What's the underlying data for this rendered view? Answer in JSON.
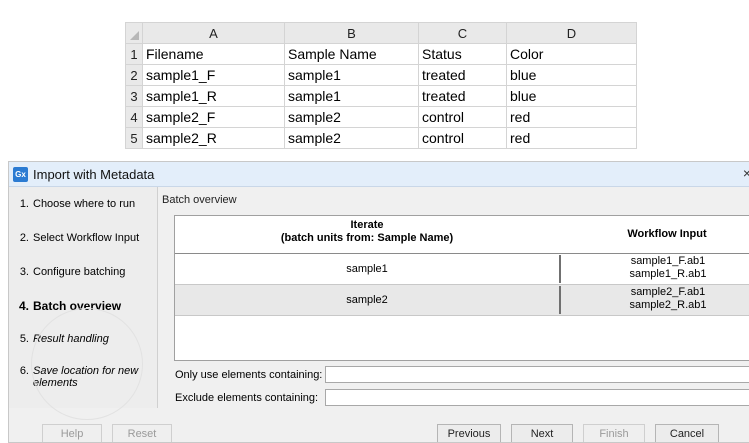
{
  "spreadsheet": {
    "column_headers": [
      "A",
      "B",
      "C",
      "D"
    ],
    "rows": [
      {
        "num": "1",
        "cells": [
          "Filename",
          "Sample Name",
          "Status",
          "Color"
        ]
      },
      {
        "num": "2",
        "cells": [
          "sample1_F",
          "sample1",
          "treated",
          "blue"
        ]
      },
      {
        "num": "3",
        "cells": [
          "sample1_R",
          "sample1",
          "treated",
          "blue"
        ]
      },
      {
        "num": "4",
        "cells": [
          "sample2_F",
          "sample2",
          "control",
          "red"
        ]
      },
      {
        "num": "5",
        "cells": [
          "sample2_R",
          "sample2",
          "control",
          "red"
        ]
      }
    ]
  },
  "dialog": {
    "icon_text": "Gx",
    "title": "Import with Metadata",
    "close_glyph": "×",
    "steps": [
      {
        "num": "1.",
        "label": "Choose where to run"
      },
      {
        "num": "2.",
        "label": "Select Workflow Input"
      },
      {
        "num": "3.",
        "label": "Configure batching"
      },
      {
        "num": "4.",
        "label": "Batch overview"
      },
      {
        "num": "5.",
        "label": "Result handling"
      },
      {
        "num": "6.",
        "label": "Save location for new elements"
      }
    ],
    "section_title": "Batch overview",
    "table": {
      "header_iterate": "Iterate",
      "header_iterate_sub": "(batch units from: Sample Name)",
      "header_input": "Workflow Input",
      "rows": [
        {
          "unit": "sample1",
          "inputs": [
            "sample1_F.ab1",
            "sample1_R.ab1"
          ]
        },
        {
          "unit": "sample2",
          "inputs": [
            "sample2_F.ab1",
            "sample2_R.ab1"
          ]
        }
      ]
    },
    "only_use_label": "Only use elements containing:",
    "only_use_value": "",
    "exclude_label": "Exclude elements containing:",
    "exclude_value": "",
    "buttons": {
      "help": "Help",
      "reset": "Reset",
      "previous": "Previous",
      "next": "Next",
      "finish": "Finish",
      "cancel": "Cancel"
    }
  },
  "colors": {
    "titlebar": "#e3eefa",
    "app_icon": "#2b7bd2",
    "dialog_bg": "#f0f0f0",
    "sheet_header": "#e9e9e9"
  }
}
